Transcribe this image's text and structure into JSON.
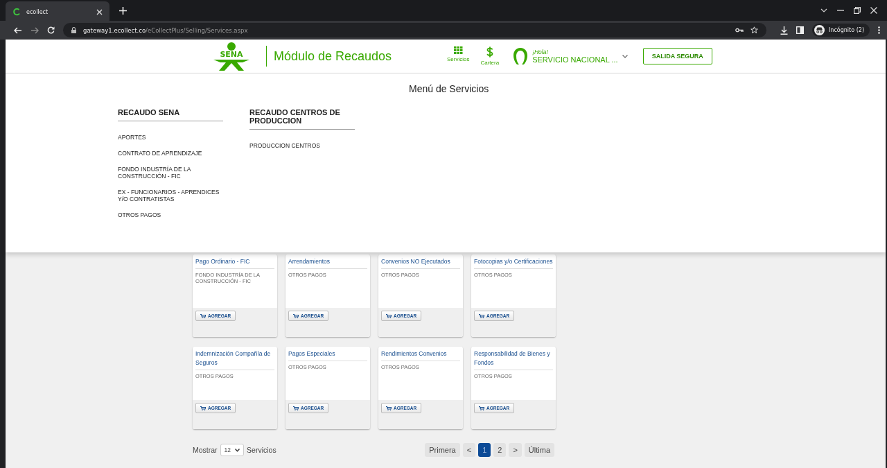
{
  "browser": {
    "tab_title": "ecollect",
    "url_host": "gateway1.ecollect.co",
    "url_path": "/eCollectPlus/Selling/Services.aspx",
    "profile": "Incógnito (2)"
  },
  "header": {
    "logo_text": "SENA",
    "title": "Módulo de Recaudos",
    "nav": [
      {
        "label": "Servicios",
        "kind": "grid"
      },
      {
        "label": "Cartera",
        "kind": "dollar"
      }
    ],
    "greeting": "¡Hola!",
    "user": "SERVICIO NACIONAL ...",
    "logout": "SALIDA SEGURA"
  },
  "menu": {
    "title": "Menú de Servicios",
    "columns": [
      {
        "heading": "RECAUDO SENA",
        "items": [
          "APORTES",
          "CONTRATO DE APRENDIZAJE",
          "FONDO INDUSTRÍA DE LA CONSTRUCCIÓN - FIC",
          "EX - FUNCIONARIOS - APRENDICES Y/O CONTRATISTAS",
          "OTROS PAGOS"
        ]
      },
      {
        "heading": "RECAUDO CENTROS DE PRODUCCION",
        "items": [
          "PRODUCCION CENTROS"
        ]
      }
    ]
  },
  "services": [
    {
      "title": "Pago Ordinario - FIC",
      "category": "FONDO INDUSTRÍA DE LA CONSTRUCCIÓN - FIC",
      "button": "AGREGAR"
    },
    {
      "title": "Arrendamientos",
      "category": "OTROS PAGOS",
      "button": "AGREGAR"
    },
    {
      "title": "Convenios NO Ejecutados",
      "category": "OTROS PAGOS",
      "button": "AGREGAR"
    },
    {
      "title": "Fotocopias y/o Certificaciones",
      "category": "OTROS PAGOS",
      "button": "AGREGAR"
    },
    {
      "title": "Indemnización Compañía de Seguros",
      "category": "OTROS PAGOS",
      "button": "AGREGAR"
    },
    {
      "title": "Pagos Especiales",
      "category": "OTROS PAGOS",
      "button": "AGREGAR"
    },
    {
      "title": "Rendimientos Convenios",
      "category": "OTROS PAGOS",
      "button": "AGREGAR"
    },
    {
      "title": "Responsabilidad de Bienes y Fondos",
      "category": "OTROS PAGOS",
      "button": "AGREGAR"
    }
  ],
  "pagination": {
    "show_label": "Mostrar",
    "page_size": "12",
    "suffix": "Servicios",
    "buttons": [
      {
        "label": "Primera",
        "selected": false
      },
      {
        "label": "<",
        "selected": false
      },
      {
        "label": "1",
        "selected": true
      },
      {
        "label": "2",
        "selected": false
      },
      {
        "label": ">",
        "selected": false
      },
      {
        "label": "Última",
        "selected": false
      }
    ]
  }
}
